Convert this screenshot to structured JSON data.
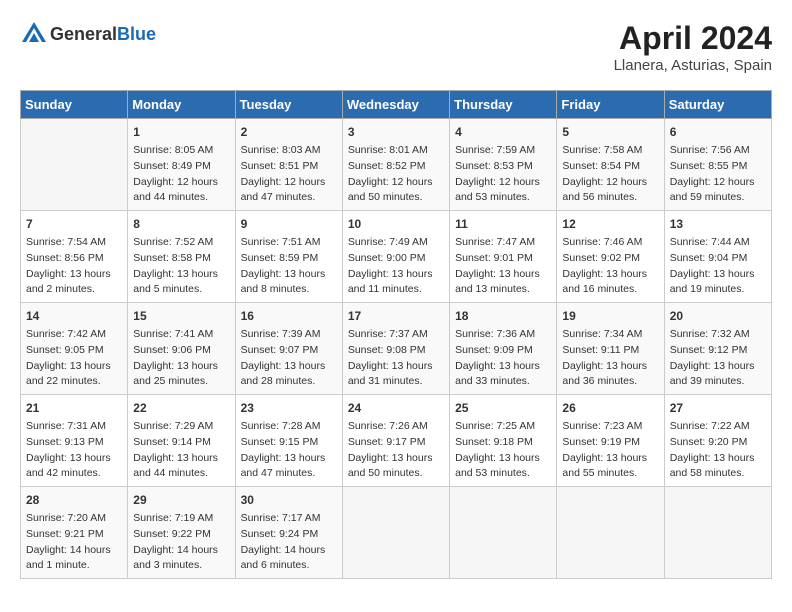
{
  "header": {
    "logo_general": "General",
    "logo_blue": "Blue",
    "month_year": "April 2024",
    "location": "Llanera, Asturias, Spain"
  },
  "columns": [
    "Sunday",
    "Monday",
    "Tuesday",
    "Wednesday",
    "Thursday",
    "Friday",
    "Saturday"
  ],
  "weeks": [
    [
      {
        "day": "",
        "sunrise": "",
        "sunset": "",
        "daylight": ""
      },
      {
        "day": "1",
        "sunrise": "Sunrise: 8:05 AM",
        "sunset": "Sunset: 8:49 PM",
        "daylight": "Daylight: 12 hours and 44 minutes."
      },
      {
        "day": "2",
        "sunrise": "Sunrise: 8:03 AM",
        "sunset": "Sunset: 8:51 PM",
        "daylight": "Daylight: 12 hours and 47 minutes."
      },
      {
        "day": "3",
        "sunrise": "Sunrise: 8:01 AM",
        "sunset": "Sunset: 8:52 PM",
        "daylight": "Daylight: 12 hours and 50 minutes."
      },
      {
        "day": "4",
        "sunrise": "Sunrise: 7:59 AM",
        "sunset": "Sunset: 8:53 PM",
        "daylight": "Daylight: 12 hours and 53 minutes."
      },
      {
        "day": "5",
        "sunrise": "Sunrise: 7:58 AM",
        "sunset": "Sunset: 8:54 PM",
        "daylight": "Daylight: 12 hours and 56 minutes."
      },
      {
        "day": "6",
        "sunrise": "Sunrise: 7:56 AM",
        "sunset": "Sunset: 8:55 PM",
        "daylight": "Daylight: 12 hours and 59 minutes."
      }
    ],
    [
      {
        "day": "7",
        "sunrise": "Sunrise: 7:54 AM",
        "sunset": "Sunset: 8:56 PM",
        "daylight": "Daylight: 13 hours and 2 minutes."
      },
      {
        "day": "8",
        "sunrise": "Sunrise: 7:52 AM",
        "sunset": "Sunset: 8:58 PM",
        "daylight": "Daylight: 13 hours and 5 minutes."
      },
      {
        "day": "9",
        "sunrise": "Sunrise: 7:51 AM",
        "sunset": "Sunset: 8:59 PM",
        "daylight": "Daylight: 13 hours and 8 minutes."
      },
      {
        "day": "10",
        "sunrise": "Sunrise: 7:49 AM",
        "sunset": "Sunset: 9:00 PM",
        "daylight": "Daylight: 13 hours and 11 minutes."
      },
      {
        "day": "11",
        "sunrise": "Sunrise: 7:47 AM",
        "sunset": "Sunset: 9:01 PM",
        "daylight": "Daylight: 13 hours and 13 minutes."
      },
      {
        "day": "12",
        "sunrise": "Sunrise: 7:46 AM",
        "sunset": "Sunset: 9:02 PM",
        "daylight": "Daylight: 13 hours and 16 minutes."
      },
      {
        "day": "13",
        "sunrise": "Sunrise: 7:44 AM",
        "sunset": "Sunset: 9:04 PM",
        "daylight": "Daylight: 13 hours and 19 minutes."
      }
    ],
    [
      {
        "day": "14",
        "sunrise": "Sunrise: 7:42 AM",
        "sunset": "Sunset: 9:05 PM",
        "daylight": "Daylight: 13 hours and 22 minutes."
      },
      {
        "day": "15",
        "sunrise": "Sunrise: 7:41 AM",
        "sunset": "Sunset: 9:06 PM",
        "daylight": "Daylight: 13 hours and 25 minutes."
      },
      {
        "day": "16",
        "sunrise": "Sunrise: 7:39 AM",
        "sunset": "Sunset: 9:07 PM",
        "daylight": "Daylight: 13 hours and 28 minutes."
      },
      {
        "day": "17",
        "sunrise": "Sunrise: 7:37 AM",
        "sunset": "Sunset: 9:08 PM",
        "daylight": "Daylight: 13 hours and 31 minutes."
      },
      {
        "day": "18",
        "sunrise": "Sunrise: 7:36 AM",
        "sunset": "Sunset: 9:09 PM",
        "daylight": "Daylight: 13 hours and 33 minutes."
      },
      {
        "day": "19",
        "sunrise": "Sunrise: 7:34 AM",
        "sunset": "Sunset: 9:11 PM",
        "daylight": "Daylight: 13 hours and 36 minutes."
      },
      {
        "day": "20",
        "sunrise": "Sunrise: 7:32 AM",
        "sunset": "Sunset: 9:12 PM",
        "daylight": "Daylight: 13 hours and 39 minutes."
      }
    ],
    [
      {
        "day": "21",
        "sunrise": "Sunrise: 7:31 AM",
        "sunset": "Sunset: 9:13 PM",
        "daylight": "Daylight: 13 hours and 42 minutes."
      },
      {
        "day": "22",
        "sunrise": "Sunrise: 7:29 AM",
        "sunset": "Sunset: 9:14 PM",
        "daylight": "Daylight: 13 hours and 44 minutes."
      },
      {
        "day": "23",
        "sunrise": "Sunrise: 7:28 AM",
        "sunset": "Sunset: 9:15 PM",
        "daylight": "Daylight: 13 hours and 47 minutes."
      },
      {
        "day": "24",
        "sunrise": "Sunrise: 7:26 AM",
        "sunset": "Sunset: 9:17 PM",
        "daylight": "Daylight: 13 hours and 50 minutes."
      },
      {
        "day": "25",
        "sunrise": "Sunrise: 7:25 AM",
        "sunset": "Sunset: 9:18 PM",
        "daylight": "Daylight: 13 hours and 53 minutes."
      },
      {
        "day": "26",
        "sunrise": "Sunrise: 7:23 AM",
        "sunset": "Sunset: 9:19 PM",
        "daylight": "Daylight: 13 hours and 55 minutes."
      },
      {
        "day": "27",
        "sunrise": "Sunrise: 7:22 AM",
        "sunset": "Sunset: 9:20 PM",
        "daylight": "Daylight: 13 hours and 58 minutes."
      }
    ],
    [
      {
        "day": "28",
        "sunrise": "Sunrise: 7:20 AM",
        "sunset": "Sunset: 9:21 PM",
        "daylight": "Daylight: 14 hours and 1 minute."
      },
      {
        "day": "29",
        "sunrise": "Sunrise: 7:19 AM",
        "sunset": "Sunset: 9:22 PM",
        "daylight": "Daylight: 14 hours and 3 minutes."
      },
      {
        "day": "30",
        "sunrise": "Sunrise: 7:17 AM",
        "sunset": "Sunset: 9:24 PM",
        "daylight": "Daylight: 14 hours and 6 minutes."
      },
      {
        "day": "",
        "sunrise": "",
        "sunset": "",
        "daylight": ""
      },
      {
        "day": "",
        "sunrise": "",
        "sunset": "",
        "daylight": ""
      },
      {
        "day": "",
        "sunrise": "",
        "sunset": "",
        "daylight": ""
      },
      {
        "day": "",
        "sunrise": "",
        "sunset": "",
        "daylight": ""
      }
    ]
  ]
}
